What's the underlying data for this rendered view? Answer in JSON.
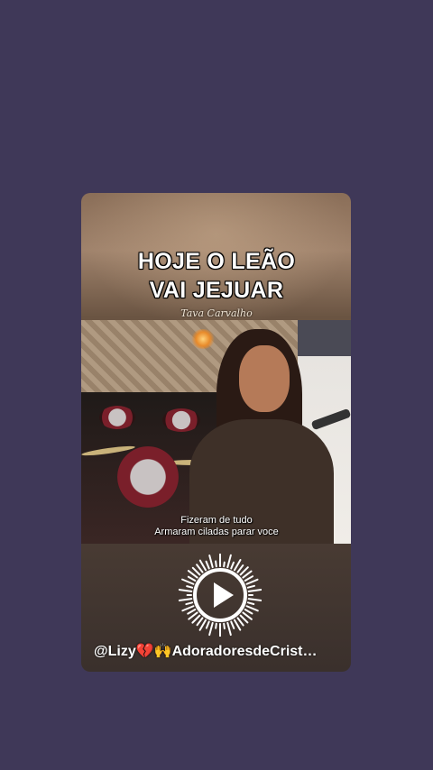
{
  "video": {
    "title_line1": "HOJE O LEÃO",
    "title_line2": "VAI JEJUAR",
    "artist": "Tava Carvalho",
    "subtitle_line1": "Fizeram de tudo",
    "subtitle_line2": "Armaram ciladas parar voce"
  },
  "handle": "@Lizy💔🙌AdoradoresdeCrist…",
  "icons": {
    "play": "play-icon",
    "audio_visualizer": "audio-visualizer-ring"
  },
  "colors": {
    "background": "#3f3858",
    "card_top": "#a0836c",
    "play_ring": "#ffffff"
  }
}
